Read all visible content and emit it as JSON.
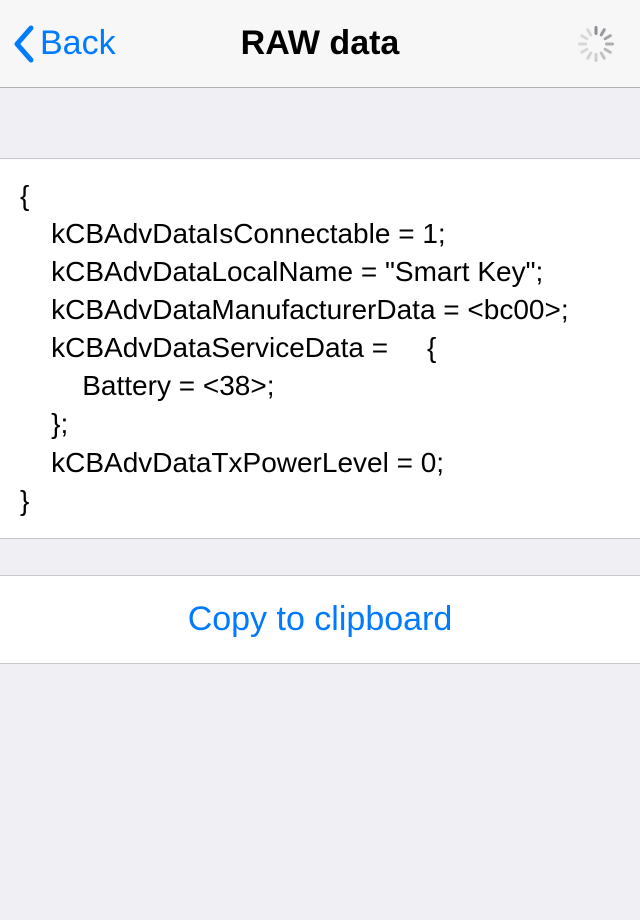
{
  "nav": {
    "back_label": "Back",
    "title": "RAW data"
  },
  "raw_data": {
    "text": "{\n    kCBAdvDataIsConnectable = 1;\n    kCBAdvDataLocalName = \"Smart Key\";\n    kCBAdvDataManufacturerData = <bc00>;\n    kCBAdvDataServiceData =     {\n        Battery = <38>;\n    };\n    kCBAdvDataTxPowerLevel = 0;\n}"
  },
  "actions": {
    "copy_label": "Copy to clipboard"
  },
  "colors": {
    "tint": "#007aff",
    "background": "#efeff4",
    "cell_bg": "#ffffff",
    "separator": "#c8c7cc"
  }
}
